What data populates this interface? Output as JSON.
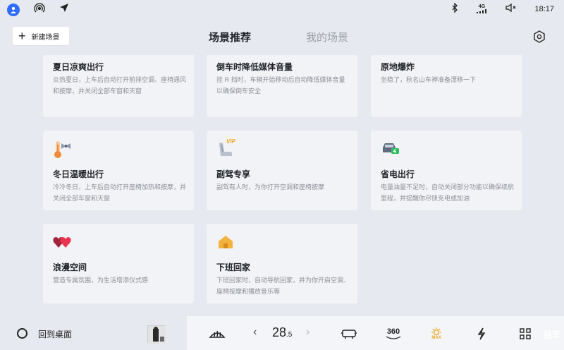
{
  "status_bar": {
    "time": "18:17",
    "signal_label": "4G"
  },
  "header": {
    "new_scene_label": "新建场景",
    "tabs": [
      {
        "label": "场景推荐"
      },
      {
        "label": "我的场景"
      }
    ]
  },
  "cards": [
    {
      "title": "夏日凉爽出行",
      "desc": "炎热夏日，上车后自动打开前排空调、座椅通风和按摩，并关闭全部车窗和天窗"
    },
    {
      "title": "倒车时降低媒体音量",
      "desc": "挂 R 挡时，车辆开始移动后自动降低媒体音量以确保倒车安全"
    },
    {
      "title": "原地爆炸",
      "desc": "坐稳了，秋名山车神准备漂移一下"
    },
    {
      "title": "冬日温暖出行",
      "desc": "冷冷冬日，上车后自动打开座椅加热和按摩，并关闭全部车窗和天窗"
    },
    {
      "title": "副驾专享",
      "desc": "副驾有人时，为你打开空调和座椅按摩",
      "badge": "VIP"
    },
    {
      "title": "省电出行",
      "desc": "电量油量不足时，自动关闭部分功能以确保续航里程，并提醒你尽快充电或加油"
    },
    {
      "title": "浪漫空间",
      "desc": "营造专属氛围，为生活增添仪式感"
    },
    {
      "title": "下班回家",
      "desc": "下班回家时，自动导航回家，并为你开启空调、座椅按摩和播放音乐等"
    }
  ],
  "bottom_bar": {
    "home_label": "回到桌面",
    "temperature_int": "28",
    "temperature_dec": ".5",
    "view360_label": "360",
    "max_label": "MAX"
  },
  "watermark": "易车",
  "colors": {
    "accent": "#2f6bff",
    "warm": "#f5a623",
    "heart": "#e8344e"
  }
}
